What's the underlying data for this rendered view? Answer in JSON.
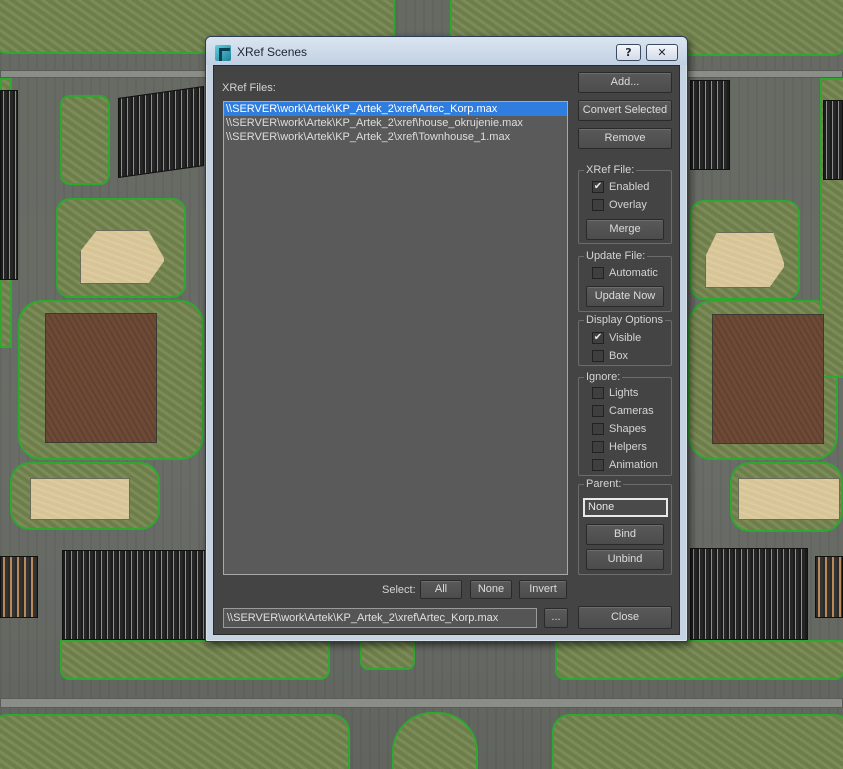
{
  "window": {
    "title": "XRef Scenes",
    "help_label": "?",
    "close_label": "✕"
  },
  "files": {
    "label": "XRef Files:",
    "items": [
      {
        "path": "\\\\SERVER\\work\\Artek\\KP_Artek_2\\xref\\Artec_Korp.max",
        "selected": true
      },
      {
        "path": "\\\\SERVER\\work\\Artek\\KP_Artek_2\\xref\\house_okrujenie.max",
        "selected": false
      },
      {
        "path": "\\\\SERVER\\work\\Artek\\KP_Artek_2\\xref\\Townhouse_1.max",
        "selected": false
      }
    ]
  },
  "buttons": {
    "add": "Add...",
    "convert": "Convert Selected",
    "remove": "Remove",
    "merge": "Merge",
    "update_now": "Update Now",
    "bind": "Bind",
    "unbind": "Unbind",
    "close": "Close",
    "browse": "..."
  },
  "xref_file": {
    "title": "XRef File:",
    "enabled": {
      "label": "Enabled",
      "checked": true
    },
    "overlay": {
      "label": "Overlay",
      "checked": false
    }
  },
  "update_file": {
    "title": "Update File:",
    "automatic": {
      "label": "Automatic",
      "checked": false
    }
  },
  "display_options": {
    "title": "Display Options",
    "visible": {
      "label": "Visible",
      "checked": true
    },
    "box": {
      "label": "Box",
      "checked": false
    }
  },
  "ignore": {
    "title": "Ignore:",
    "lights": {
      "label": "Lights",
      "checked": false
    },
    "cameras": {
      "label": "Cameras",
      "checked": false
    },
    "shapes": {
      "label": "Shapes",
      "checked": false
    },
    "helpers": {
      "label": "Helpers",
      "checked": false
    },
    "animation": {
      "label": "Animation",
      "checked": false
    }
  },
  "parent": {
    "title": "Parent:",
    "value": "None"
  },
  "select": {
    "label": "Select:",
    "all": "All",
    "none": "None",
    "invert": "Invert"
  },
  "path_field": {
    "value": "\\\\SERVER\\work\\Artek\\KP_Artek_2\\xref\\Artec_Korp.max"
  },
  "colors": {
    "selection": "#2f7ddf",
    "dialog_bg": "#444444",
    "lawn": "#75864f",
    "lawn_edge": "#2fa82f"
  }
}
